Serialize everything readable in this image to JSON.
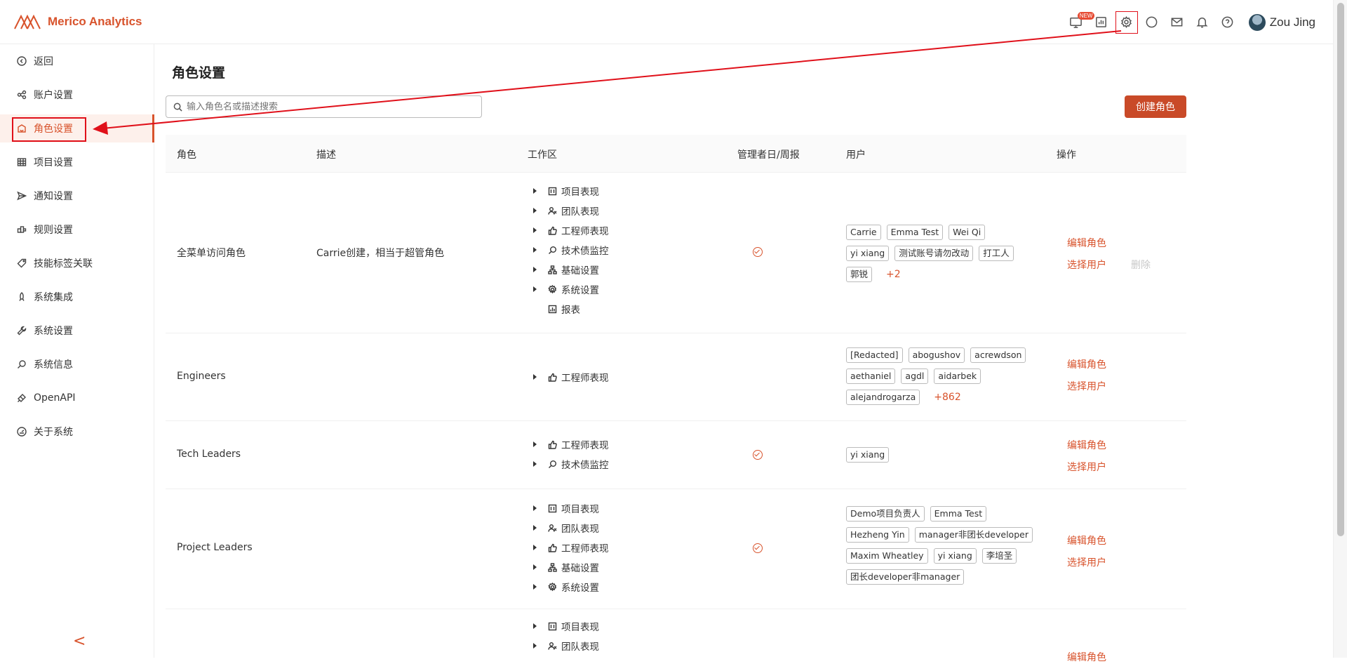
{
  "app": {
    "name": "Merico Analytics",
    "brand_color": "#d8532c"
  },
  "header": {
    "new_badge": "NEW",
    "icons": [
      "monitor-icon",
      "report-icon",
      "gear-icon",
      "chat-icon",
      "mail-icon",
      "bell-icon",
      "help-icon"
    ],
    "user_name": "Zou Jing"
  },
  "sidebar": {
    "items": [
      {
        "label": "返回",
        "icon": "back-icon"
      },
      {
        "label": "账户设置",
        "icon": "account-icon"
      },
      {
        "label": "角色设置",
        "icon": "role-icon",
        "active": true
      },
      {
        "label": "项目设置",
        "icon": "grid-icon"
      },
      {
        "label": "通知设置",
        "icon": "send-icon"
      },
      {
        "label": "规则设置",
        "icon": "rules-icon"
      },
      {
        "label": "技能标签关联",
        "icon": "tag-icon"
      },
      {
        "label": "系统集成",
        "icon": "rocket-icon"
      },
      {
        "label": "系统设置",
        "icon": "wrench-icon"
      },
      {
        "label": "系统信息",
        "icon": "info-search-icon"
      },
      {
        "label": "OpenAPI",
        "icon": "api-icon"
      },
      {
        "label": "关于系统",
        "icon": "about-icon"
      }
    ],
    "collapse": "<"
  },
  "main": {
    "title": "角色设置",
    "search_placeholder": "输入角色名或描述搜索",
    "create_button": "创建角色",
    "columns": [
      "角色",
      "描述",
      "工作区",
      "管理者日/周报",
      "用户",
      "操作"
    ],
    "actions": {
      "edit": "编辑角色",
      "select_users": "选择用户",
      "delete": "删除"
    },
    "rows": [
      {
        "role": "全菜单访问角色",
        "desc": "Carrie创建，相当于超管角色",
        "workspaces": [
          "项目表现",
          "团队表现",
          "工程师表现",
          "技术债监控",
          "基础设置",
          "系统设置",
          "报表"
        ],
        "report": true,
        "users": [
          "Carrie",
          "Emma Test",
          "Wei Qi",
          "yi xiang",
          "测试账号请勿改动",
          "打工人",
          "郭锐"
        ],
        "more": "+2",
        "can_delete": false
      },
      {
        "role": "Engineers",
        "desc": "",
        "workspaces": [
          "工程师表现"
        ],
        "report": false,
        "users": [
          "[Redacted]",
          "abogushov",
          "acrewdson",
          "aethaniel",
          "agdl",
          "aidarbek",
          "alejandrogarza"
        ],
        "more": "+862"
      },
      {
        "role": "Tech Leaders",
        "desc": "",
        "workspaces": [
          "工程师表现",
          "技术债监控"
        ],
        "report": true,
        "users": [
          "yi xiang"
        ]
      },
      {
        "role": "Project Leaders",
        "desc": "",
        "workspaces": [
          "项目表现",
          "团队表现",
          "工程师表现",
          "基础设置",
          "系统设置"
        ],
        "report": true,
        "users": [
          "Demo项目负责人",
          "Emma Test",
          "Hezheng Yin",
          "manager非团长developer",
          "Maxim Wheatley",
          "yi xiang",
          "李培圣",
          "团长developer非manager"
        ]
      },
      {
        "workspaces": [
          "项目表现",
          "团队表现"
        ],
        "partial_action": "编辑角色"
      }
    ]
  }
}
